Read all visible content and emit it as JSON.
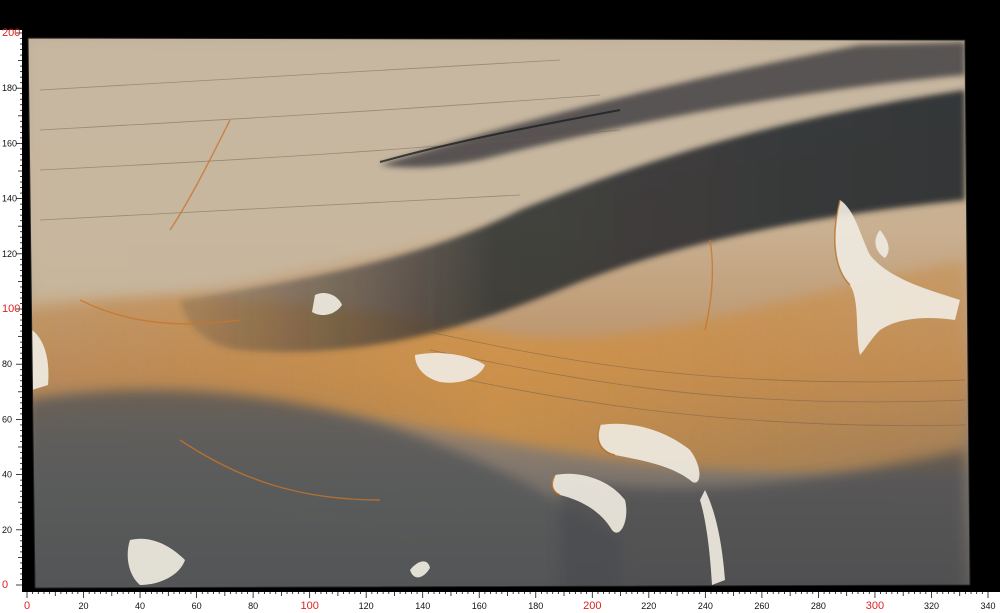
{
  "image": {
    "subject": "polished stone slab",
    "background_color": "#000000",
    "ruler_color": "#ffffff",
    "major_label_color": "#dd2222",
    "minor_label_color": "#111111"
  },
  "ruler_bottom": {
    "labels": [
      "0",
      "20",
      "40",
      "60",
      "80",
      "100",
      "120",
      "140",
      "160",
      "180",
      "200",
      "220",
      "240",
      "260",
      "280",
      "300",
      "320",
      "340"
    ],
    "major_labels": [
      "0",
      "100",
      "200",
      "300"
    ]
  },
  "ruler_left": {
    "labels": [
      "0",
      "20",
      "40",
      "60",
      "80",
      "100",
      "120",
      "140",
      "160",
      "180",
      "200"
    ],
    "major_labels": [
      "0",
      "100",
      "200"
    ]
  }
}
